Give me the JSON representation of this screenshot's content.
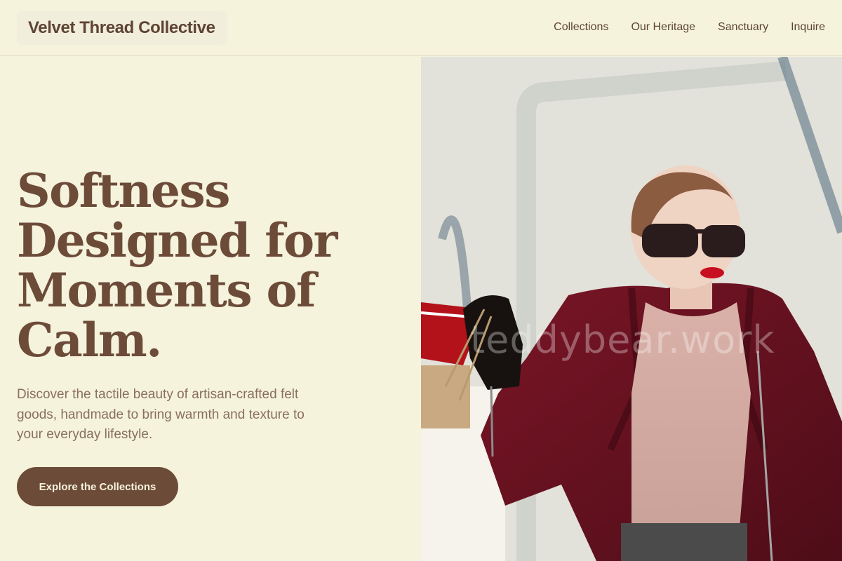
{
  "header": {
    "brand": "Velvet Thread Collective",
    "nav": [
      {
        "label": "Collections"
      },
      {
        "label": "Our Heritage"
      },
      {
        "label": "Sanctuary"
      },
      {
        "label": "Inquire"
      }
    ]
  },
  "hero": {
    "headline": "Softness Designed for Moments of Calm.",
    "subtext": "Discover the tactile beauty of artisan-crafted felt goods, handmade to bring warmth and texture to your everyday lifestyle.",
    "cta_label": "Explore the Collections",
    "image": {
      "subject": "woman in burgundy coat and sunglasses holding shopping bags",
      "watermark": "teddybear.work"
    }
  },
  "colors": {
    "background": "#f5f3dc",
    "primary": "#6d4b39",
    "text_muted": "#8a6f60"
  }
}
